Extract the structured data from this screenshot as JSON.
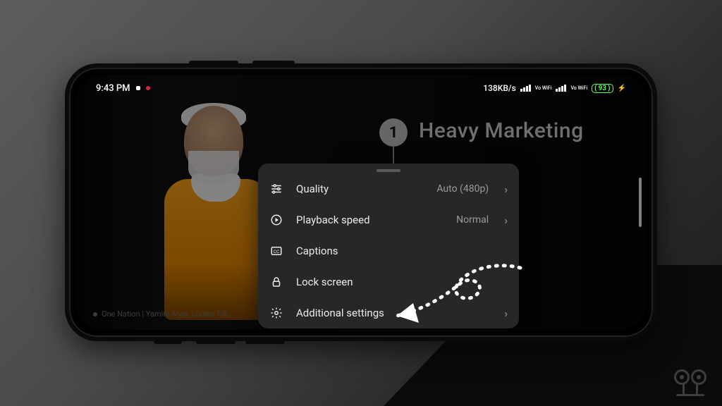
{
  "statusbar": {
    "time": "9:43 PM",
    "net_rate": "138KB/s",
    "vowifi_label": "Vo WiFi",
    "battery_pct": "93"
  },
  "video": {
    "badge_number": "1",
    "heading": "Heavy Marketing",
    "caption": "One Nation | Yamini Aiyar, Louise Till..."
  },
  "menu": {
    "items": [
      {
        "icon": "tune-icon",
        "label": "Quality",
        "value": "Auto (480p)",
        "chevron": true
      },
      {
        "icon": "play-icon",
        "label": "Playback speed",
        "value": "Normal",
        "chevron": true
      },
      {
        "icon": "cc-icon",
        "label": "Captions",
        "value": "",
        "chevron": false
      },
      {
        "icon": "lock-icon",
        "label": "Lock screen",
        "value": "",
        "chevron": false
      },
      {
        "icon": "gear-icon",
        "label": "Additional settings",
        "value": "",
        "chevron": true
      }
    ]
  }
}
